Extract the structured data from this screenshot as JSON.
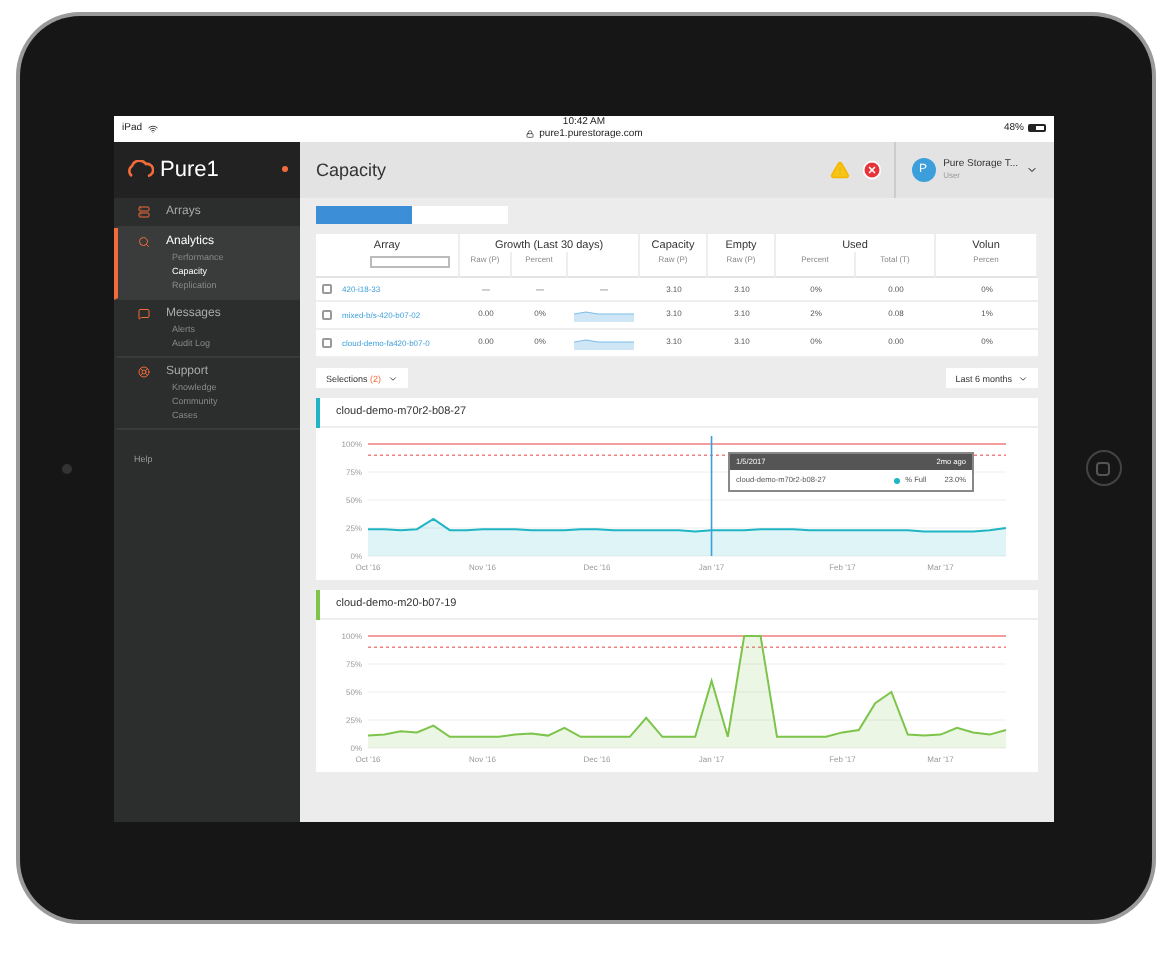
{
  "status_bar": {
    "device": "iPad",
    "time": "10:42 AM",
    "url": "pure1.purestorage.com",
    "battery": "48%"
  },
  "sidebar": {
    "logo": "Pure1",
    "sections": [
      {
        "label": "Arrays",
        "selected": false
      },
      {
        "label": "Analytics",
        "selected": true,
        "items": [
          {
            "label": "Performance",
            "selected": false
          },
          {
            "label": "Capacity",
            "selected": true
          },
          {
            "label": "Replication",
            "selected": false
          }
        ]
      },
      {
        "label": "Messages",
        "selected": false,
        "items": [
          {
            "label": "Alerts",
            "selected": false
          },
          {
            "label": "Audit Log",
            "selected": false
          }
        ]
      },
      {
        "label": "Support",
        "selected": false,
        "items": [
          {
            "label": "Knowledge",
            "selected": false
          },
          {
            "label": "Community",
            "selected": false
          },
          {
            "label": "Cases",
            "selected": false
          }
        ]
      }
    ],
    "help": "Help"
  },
  "header": {
    "title": "Capacity",
    "user": {
      "initial": "P",
      "name": "Pure Storage T...",
      "role": "User"
    }
  },
  "view_toggle": [
    {
      "selected": true
    },
    {
      "selected": false
    }
  ],
  "table": {
    "groups": [
      {
        "label": "Array",
        "columns": [
          {
            "kind": "filter"
          }
        ]
      },
      {
        "label": "Growth (Last 30 days)",
        "columns": [
          {
            "kind": "text",
            "label": "Raw (P)"
          },
          {
            "kind": "text",
            "label": "Percent"
          },
          {
            "kind": "spark"
          }
        ]
      },
      {
        "label": "Capacity",
        "columns": [
          {
            "kind": "text",
            "label": "Raw (P)"
          }
        ]
      },
      {
        "label": "Empty",
        "columns": [
          {
            "kind": "text",
            "label": "Raw (P)"
          }
        ]
      },
      {
        "label": "Used",
        "columns": [
          {
            "kind": "text",
            "label": "Percent"
          },
          {
            "kind": "text",
            "label": "Total (T)"
          }
        ]
      },
      {
        "label": "Volun",
        "columns": [
          {
            "kind": "text",
            "label": "Percen"
          }
        ]
      }
    ],
    "rows": [
      {
        "checked": false,
        "name": "420-i18-33",
        "cells": [
          {
            "kind": "text",
            "text": "—"
          },
          {
            "kind": "text",
            "text": "—"
          },
          {
            "kind": "text",
            "text": "—"
          },
          {
            "kind": "text",
            "text": "3.10"
          },
          {
            "kind": "text",
            "text": "3.10"
          },
          {
            "kind": "text",
            "text": "0%"
          },
          {
            "kind": "text",
            "text": "0.00"
          },
          {
            "kind": "text",
            "text": "0%"
          }
        ]
      },
      {
        "checked": false,
        "name": "mixed-b/s-420-b07-02",
        "cells": [
          {
            "kind": "text",
            "text": "0.00"
          },
          {
            "kind": "text",
            "text": "0%"
          },
          {
            "kind": "spark"
          },
          {
            "kind": "text",
            "text": "3.10"
          },
          {
            "kind": "text",
            "text": "3.10"
          },
          {
            "kind": "text",
            "text": "2%"
          },
          {
            "kind": "text",
            "text": "0.08"
          },
          {
            "kind": "text",
            "text": "1%"
          }
        ]
      },
      {
        "checked": false,
        "name": "cloud-demo-fa420-b07-0",
        "cells": [
          {
            "kind": "text",
            "text": "0.00"
          },
          {
            "kind": "text",
            "text": "0%"
          },
          {
            "kind": "spark"
          },
          {
            "kind": "text",
            "text": "3.10"
          },
          {
            "kind": "text",
            "text": "3.10"
          },
          {
            "kind": "text",
            "text": "0%"
          },
          {
            "kind": "text",
            "text": "0.00"
          },
          {
            "kind": "text",
            "text": "0%"
          }
        ]
      }
    ]
  },
  "selections": {
    "label": "Selections",
    "count": "(2)"
  },
  "range": "Last 6 months",
  "charts": [
    {
      "title": "cloud-demo-m70r2-b08-27",
      "color": "#1fb5c4",
      "tooltip": {
        "date": "1/5/2017",
        "ago": "2mo ago",
        "series": "cloud-demo-m70r2-b08-27",
        "value": "23.0%"
      },
      "chart_data": {
        "type": "area",
        "categories": [
          "Oct '16",
          null,
          null,
          null,
          null,
          null,
          null,
          "Nov '16",
          null,
          null,
          null,
          null,
          null,
          null,
          "Dec '16",
          null,
          null,
          null,
          null,
          null,
          null,
          "Jan '17",
          null,
          null,
          null,
          null,
          null,
          null,
          null,
          "Feb '17",
          null,
          null,
          null,
          null,
          null,
          "Mar '17",
          null,
          null,
          null,
          null
        ],
        "ylim": [
          0,
          100
        ],
        "series": [
          {
            "name": "% Full",
            "color": "#1fb5c4",
            "values": [
              24,
              24,
              23,
              24,
              33,
              23,
              23,
              24,
              24,
              24,
              23,
              23,
              23,
              24,
              24,
              23,
              23,
              23,
              23,
              23,
              22,
              23,
              23,
              23,
              24,
              24,
              24,
              23,
              23,
              23,
              23,
              23,
              23,
              23,
              22,
              22,
              22,
              22,
              23,
              25
            ]
          }
        ],
        "yticks": [
          {
            "value": 0,
            "label": "0%"
          },
          {
            "value": 25,
            "label": "25%"
          },
          {
            "value": 50,
            "label": "50%"
          },
          {
            "value": 75,
            "label": "75%"
          },
          {
            "value": 100,
            "label": "100%"
          }
        ],
        "grid": true,
        "ref_lines": [
          {
            "axis": "y",
            "value": 100
          },
          {
            "axis": "y",
            "value": 90
          }
        ]
      }
    },
    {
      "title": "cloud-demo-m20-b07-19",
      "color": "#7cc44a",
      "chart_data": {
        "type": "area",
        "categories": [
          "Oct '16",
          null,
          null,
          null,
          null,
          null,
          null,
          "Nov '16",
          null,
          null,
          null,
          null,
          null,
          null,
          "Dec '16",
          null,
          null,
          null,
          null,
          null,
          null,
          "Jan '17",
          null,
          null,
          null,
          null,
          null,
          null,
          null,
          "Feb '17",
          null,
          null,
          null,
          null,
          null,
          "Mar '17",
          null,
          null,
          null,
          null
        ],
        "ylim": [
          0,
          100
        ],
        "series": [
          {
            "color": "#7cc44a",
            "values": [
              11,
              12,
              15,
              14,
              20,
              10,
              10,
              10,
              10,
              12,
              13,
              11,
              18,
              10,
              10,
              10,
              10,
              27,
              10,
              10,
              10,
              60,
              10,
              100,
              100,
              10,
              10,
              10,
              10,
              14,
              16,
              40,
              50,
              12,
              11,
              12,
              18,
              14,
              12,
              16
            ]
          }
        ],
        "yticks": [
          {
            "value": 0,
            "label": "0%"
          },
          {
            "value": 25,
            "label": "25%"
          },
          {
            "value": 50,
            "label": "50%"
          },
          {
            "value": 75,
            "label": "75%"
          },
          {
            "value": 100,
            "label": "100%"
          }
        ],
        "grid": true,
        "ref_lines": [
          {
            "axis": "y",
            "value": 100
          },
          {
            "axis": "y",
            "value": 90
          }
        ]
      }
    }
  ]
}
